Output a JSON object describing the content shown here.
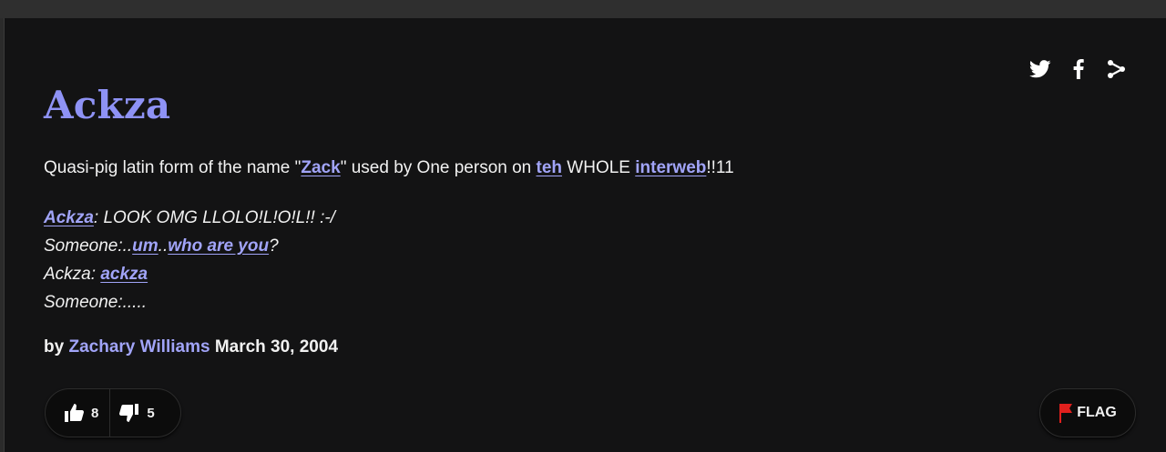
{
  "definition": {
    "word": "Ackza",
    "meaning": [
      {
        "text": "Quasi-pig latin form of the name \""
      },
      {
        "text": "Zack",
        "link": true
      },
      {
        "text": "\" used by One person on "
      },
      {
        "text": "teh",
        "link": true
      },
      {
        "text": " WHOLE "
      },
      {
        "text": "interweb",
        "link": true
      },
      {
        "text": "!!11"
      }
    ],
    "example": [
      [
        {
          "text": "Ackza",
          "link": true
        },
        {
          "text": ": LOOK OMG LLOLO!L!O!L!! :-/"
        }
      ],
      [
        {
          "text": "Someone:.."
        },
        {
          "text": "um",
          "link": true
        },
        {
          "text": ".."
        },
        {
          "text": "who are you",
          "link": true
        },
        {
          "text": "?"
        }
      ],
      [
        {
          "text": "Ackza: "
        },
        {
          "text": "ackza",
          "link": true
        }
      ],
      [
        {
          "text": "Someone:....."
        }
      ]
    ],
    "contributor": {
      "by": "by",
      "author": "Zachary Williams",
      "date": "March 30, 2004"
    },
    "votes": {
      "up": "8",
      "down": "5"
    },
    "flag_label": "FLAG"
  },
  "share": {
    "icons": [
      "twitter-icon",
      "facebook-icon",
      "share-icon"
    ]
  },
  "colors": {
    "background": "#131314",
    "accent": "#8e92f5",
    "link": "#a1a4f8",
    "text": "#f1f1f1",
    "flag": "#e0201d"
  }
}
